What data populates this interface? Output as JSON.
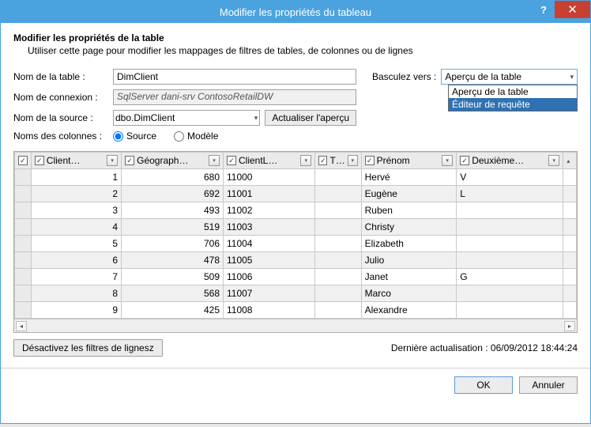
{
  "titlebar": {
    "title": "Modifier les propriétés du tableau"
  },
  "header": {
    "heading": "Modifier les propriétés de la table",
    "sub": "Utiliser cette page pour modifier les mappages de filtres de tables, de colonnes ou de lignes"
  },
  "form": {
    "table_name_label": "Nom de la table :",
    "table_name_value": "DimClient",
    "connection_label": "Nom de connexion :",
    "connection_value": "SqlServer dani-srv ContosoRetailDW",
    "source_label": "Nom de la source :",
    "source_value": "dbo.DimClient",
    "refresh_label": "Actualiser l'aperçu",
    "colnames_label": "Noms des colonnes :",
    "radio_source": "Source",
    "radio_model": "Modèle"
  },
  "switch": {
    "label": "Basculez vers :",
    "value": "Aperçu de la table",
    "options": [
      "Aperçu de la table",
      "Éditeur de requête"
    ],
    "highlighted_index": 1
  },
  "grid": {
    "columns": [
      "Client…",
      "Géograph…",
      "ClientL…",
      "T…",
      "Prénom",
      "Deuxième…"
    ],
    "rows": [
      {
        "n": 1,
        "client": "1",
        "geo": "680",
        "clientl": "11000",
        "t": "",
        "prenom": "Hervé",
        "deux": "V"
      },
      {
        "n": 2,
        "client": "2",
        "geo": "692",
        "clientl": "11001",
        "t": "",
        "prenom": "Eugène",
        "deux": "L"
      },
      {
        "n": 3,
        "client": "3",
        "geo": "493",
        "clientl": "11002",
        "t": "",
        "prenom": "Ruben",
        "deux": ""
      },
      {
        "n": 4,
        "client": "4",
        "geo": "519",
        "clientl": "11003",
        "t": "",
        "prenom": "Christy",
        "deux": ""
      },
      {
        "n": 5,
        "client": "5",
        "geo": "706",
        "clientl": "11004",
        "t": "",
        "prenom": "Elizabeth",
        "deux": ""
      },
      {
        "n": 6,
        "client": "6",
        "geo": "478",
        "clientl": "11005",
        "t": "",
        "prenom": "Julio",
        "deux": ""
      },
      {
        "n": 7,
        "client": "7",
        "geo": "509",
        "clientl": "11006",
        "t": "",
        "prenom": "Janet",
        "deux": "G"
      },
      {
        "n": 8,
        "client": "8",
        "geo": "568",
        "clientl": "11007",
        "t": "",
        "prenom": "Marco",
        "deux": ""
      },
      {
        "n": 9,
        "client": "9",
        "geo": "425",
        "clientl": "11008",
        "t": "",
        "prenom": "Alexandre",
        "deux": ""
      }
    ]
  },
  "under": {
    "disable_filters": "Désactivez les filtres de lignesz",
    "last_updated": "Dernière actualisation : 06/09/2012 18:44:24"
  },
  "footer": {
    "ok": "OK",
    "cancel": "Annuler"
  }
}
